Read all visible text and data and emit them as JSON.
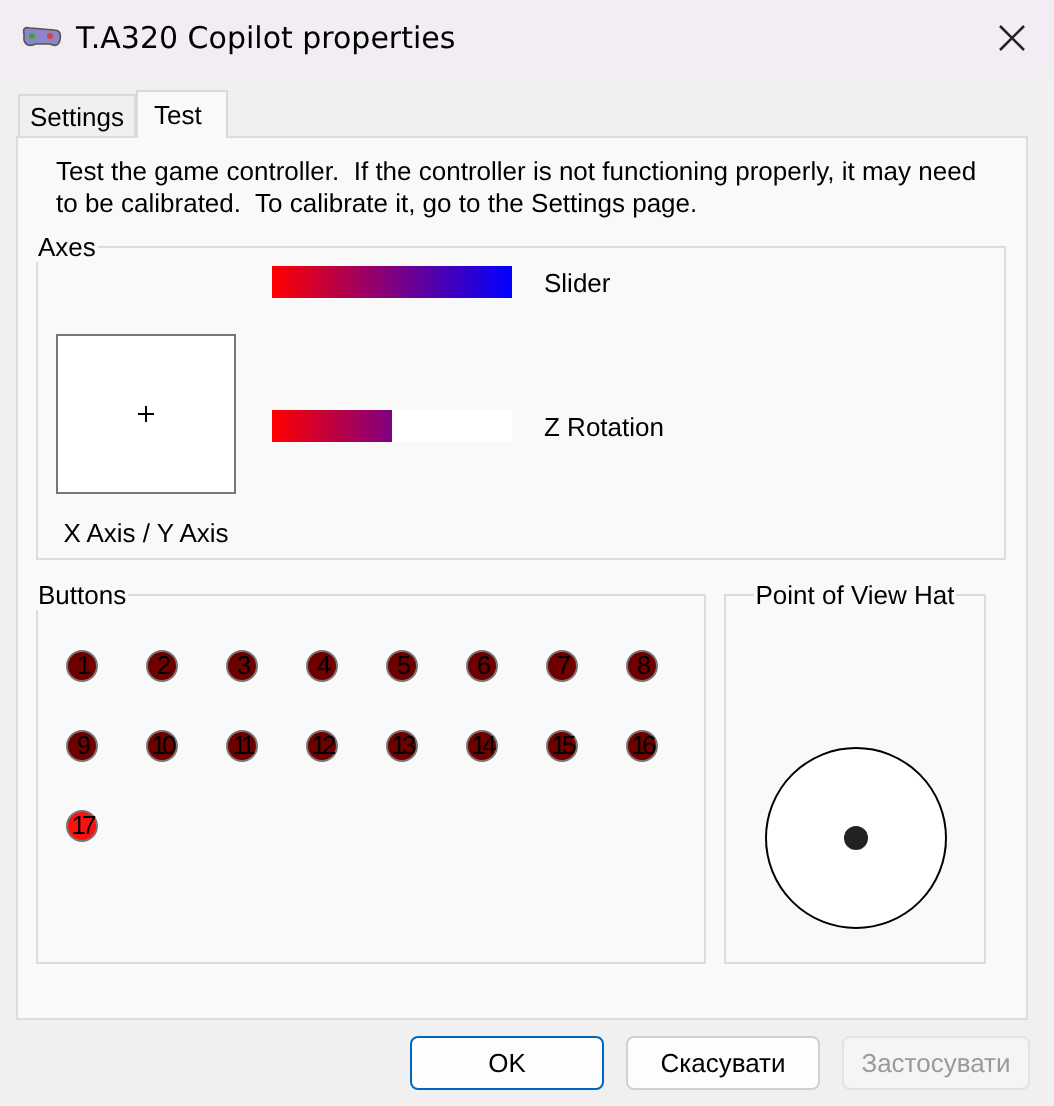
{
  "window": {
    "title": "T.A320 Copilot properties"
  },
  "tabs": [
    {
      "label": "Settings",
      "selected": false
    },
    {
      "label": "Test",
      "selected": true
    }
  ],
  "description": "Test the game controller.  If the controller is not functioning properly, it may need to be calibrated.  To calibrate it, go to the Settings page.",
  "axes": {
    "title": "Axes",
    "xy_label": "X Axis / Y Axis",
    "bars": [
      {
        "label": "Slider",
        "level": 1
      },
      {
        "label": "Z Rotation",
        "level": 0.5
      }
    ]
  },
  "buttons_group": {
    "title": "Buttons",
    "buttons": [
      {
        "label": "1",
        "pressed": false
      },
      {
        "label": "2",
        "pressed": false
      },
      {
        "label": "3",
        "pressed": false
      },
      {
        "label": "4",
        "pressed": false
      },
      {
        "label": "5",
        "pressed": false
      },
      {
        "label": "6",
        "pressed": false
      },
      {
        "label": "7",
        "pressed": false
      },
      {
        "label": "8",
        "pressed": false
      },
      {
        "label": "9",
        "pressed": false
      },
      {
        "label": "10",
        "pressed": false
      },
      {
        "label": "11",
        "pressed": false
      },
      {
        "label": "12",
        "pressed": false
      },
      {
        "label": "13",
        "pressed": false
      },
      {
        "label": "14",
        "pressed": false
      },
      {
        "label": "15",
        "pressed": false
      },
      {
        "label": "16",
        "pressed": false
      },
      {
        "label": "17",
        "pressed": true
      }
    ]
  },
  "pov": {
    "title": "Point of View Hat"
  },
  "dialog_buttons": [
    {
      "label": "OK",
      "default": true,
      "disabled": false
    },
    {
      "label": "Скасувати",
      "default": false,
      "disabled": false
    },
    {
      "label": "Застосувати",
      "default": false,
      "disabled": true
    }
  ]
}
